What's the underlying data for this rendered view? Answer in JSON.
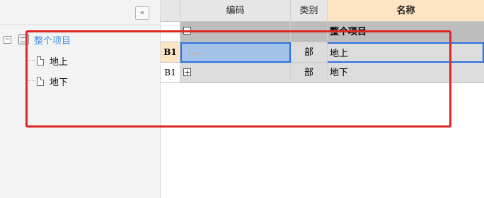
{
  "tree": {
    "collapse_glyph": "«",
    "root": {
      "toggle": "−",
      "label": "整个项目"
    },
    "children": [
      {
        "label": "地上"
      },
      {
        "label": "地下"
      }
    ]
  },
  "grid": {
    "columns": {
      "code": "编码",
      "category": "类别",
      "name": "名称"
    },
    "rows": [
      {
        "index": "",
        "code": "",
        "category": "",
        "name": "整个项目",
        "toggle": "−"
      },
      {
        "index": "B1",
        "code": "",
        "category": "部",
        "name": "地上",
        "selected": true
      },
      {
        "index": "B1",
        "code": "",
        "category": "部",
        "name": "地下",
        "toggle": "+"
      }
    ]
  },
  "colors": {
    "accent_blue": "#3c8de6",
    "selection_border": "#2a6fe0",
    "selection_fill": "#a5c2eb",
    "header_highlight": "#fde4c3",
    "annotation_red": "#e02525"
  }
}
